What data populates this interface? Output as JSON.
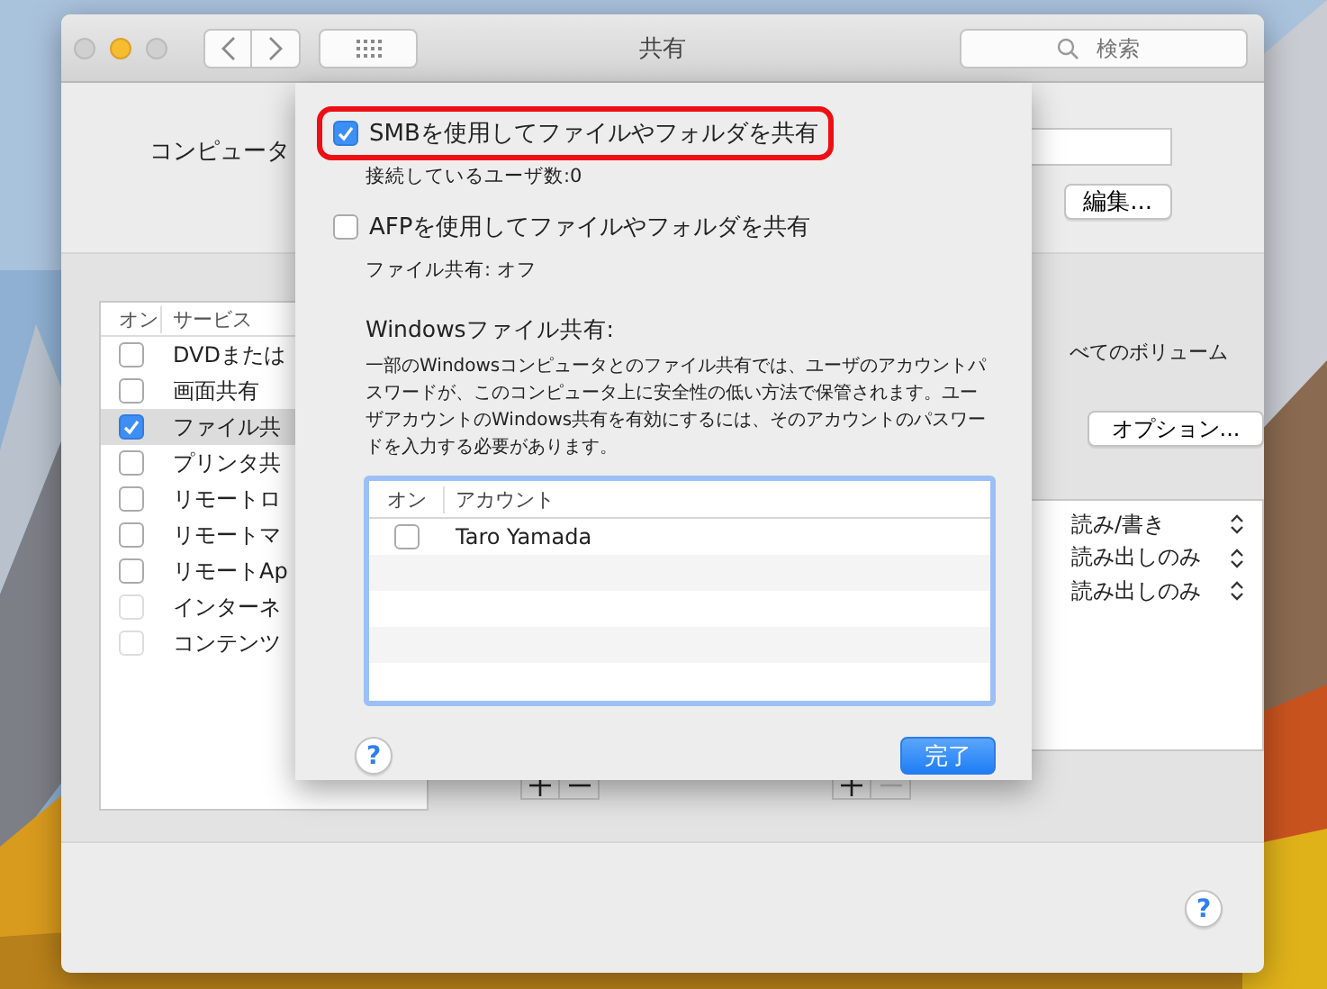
{
  "window": {
    "title": "共有"
  },
  "toolbar": {
    "search": {
      "placeholder": "検索"
    }
  },
  "computer_name": {
    "label": "コンピュータ"
  },
  "edit_button": "編集...",
  "services": {
    "columns": [
      "オン",
      "サービス"
    ],
    "rows": [
      {
        "name": "DVDまたは",
        "checked": false,
        "selected": false,
        "disabled": false
      },
      {
        "name": "画面共有",
        "checked": false,
        "selected": false,
        "disabled": false
      },
      {
        "name": "ファイル共",
        "checked": true,
        "selected": true,
        "disabled": false
      },
      {
        "name": "プリンタ共",
        "checked": false,
        "selected": false,
        "disabled": false
      },
      {
        "name": "リモートロ",
        "checked": false,
        "selected": false,
        "disabled": false
      },
      {
        "name": "リモートマ",
        "checked": false,
        "selected": false,
        "disabled": false
      },
      {
        "name": "リモートAp",
        "checked": false,
        "selected": false,
        "disabled": false
      },
      {
        "name": "インターネ",
        "checked": false,
        "selected": false,
        "disabled": true
      },
      {
        "name": "コンテンツ",
        "checked": false,
        "selected": false,
        "disabled": true
      }
    ]
  },
  "help_button": "?",
  "access_note": "べてのボリューム",
  "options_button": "オプション...",
  "permissions": [
    "読み/書き",
    "読み出しのみ",
    "読み出しのみ"
  ],
  "sheet": {
    "options": [
      {
        "label": "SMBを使用してファイルやフォルダを共有",
        "checked": true,
        "highlighted": true,
        "detail": "接続しているユーザ数:0"
      },
      {
        "label": "AFPを使用してファイルやフォルダを共有",
        "checked": false,
        "highlighted": false,
        "detail": "ファイル共有: オフ"
      }
    ],
    "windows_heading": "Windowsファイル共有:",
    "windows_description": "一部のWindowsコンピュータとのファイル共有では、ユーザのアカウントパスワードが、このコンピュータ上に安全性の低い方法で保管されます。ユーザアカウントのWindows共有を有効にするには、そのアカウントのパスワードを入力する必要があります。",
    "accounts": {
      "columns": [
        "オン",
        "アカウント"
      ],
      "rows": [
        {
          "name": "Taro Yamada",
          "checked": false
        }
      ]
    },
    "help_button": "?",
    "done_button": "完了"
  }
}
